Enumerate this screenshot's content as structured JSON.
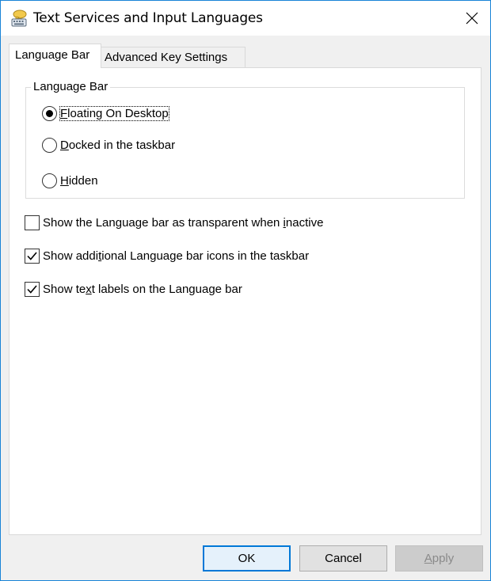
{
  "window": {
    "title": "Text Services and Input Languages",
    "accent_color": "#1883d7"
  },
  "tabs": [
    {
      "label": "Language Bar",
      "active": true
    },
    {
      "label": "Advanced Key Settings",
      "active": false
    }
  ],
  "language_bar_group": {
    "label": "Language Bar",
    "options": [
      {
        "label_pre": "",
        "mnemonic": "F",
        "label_post": "loating On Desktop",
        "checked": true
      },
      {
        "label_pre": "",
        "mnemonic": "D",
        "label_post": "ocked in the taskbar",
        "checked": false
      },
      {
        "label_pre": "",
        "mnemonic": "H",
        "label_post": "idden",
        "checked": false
      }
    ]
  },
  "checkboxes": [
    {
      "label_pre": "Show the Language bar as transparent when ",
      "mnemonic": "i",
      "label_post": "nactive",
      "checked": false
    },
    {
      "label_pre": "Show addi",
      "mnemonic": "t",
      "label_post": "ional Language bar icons in the taskbar",
      "checked": true
    },
    {
      "label_pre": "Show te",
      "mnemonic": "x",
      "label_post": "t labels on the Language bar",
      "checked": true
    }
  ],
  "buttons": {
    "ok": "OK",
    "cancel": "Cancel",
    "apply_mnemonic": "A",
    "apply_rest": "pply"
  }
}
